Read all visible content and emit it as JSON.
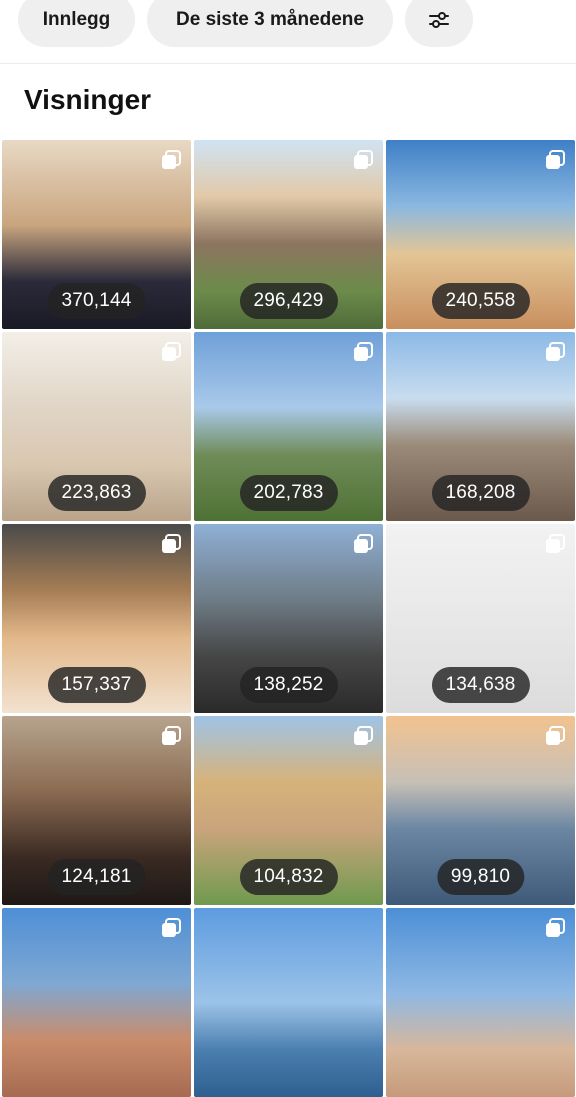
{
  "filters": {
    "posts_label": "Innlegg",
    "period_label": "De siste 3 månedene",
    "filter_icon": "sliders-icon"
  },
  "section": {
    "title": "Visninger"
  },
  "posts": [
    {
      "views": "370,144"
    },
    {
      "views": "296,429"
    },
    {
      "views": "240,558"
    },
    {
      "views": "223,863"
    },
    {
      "views": "202,783"
    },
    {
      "views": "168,208"
    },
    {
      "views": "157,337"
    },
    {
      "views": "138,252"
    },
    {
      "views": "134,638"
    },
    {
      "views": "124,181"
    },
    {
      "views": "104,832"
    },
    {
      "views": "99,810"
    },
    {
      "views": ""
    },
    {
      "views": ""
    },
    {
      "views": ""
    }
  ]
}
